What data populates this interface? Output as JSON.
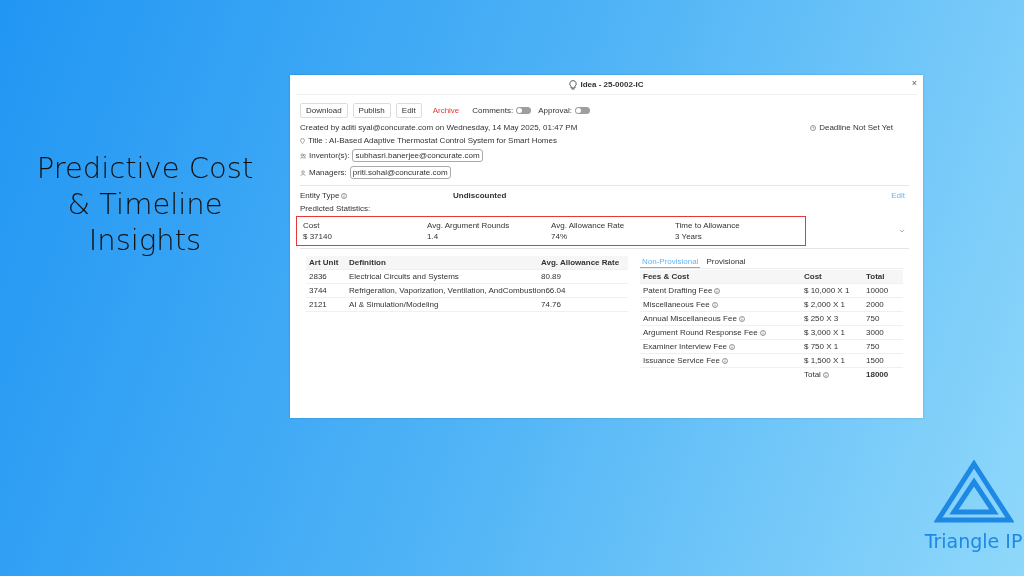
{
  "slide": {
    "heading": "Predictive Cost & Timeline Insights",
    "logo_text": "Triangle IP"
  },
  "window": {
    "title": "Idea - 25-0002-IC",
    "close": "×"
  },
  "toolbar": {
    "actions": [
      {
        "label": "Download",
        "kind": "button"
      },
      {
        "label": "Publish",
        "kind": "button"
      },
      {
        "label": "Edit",
        "kind": "button"
      },
      {
        "label": "Archive",
        "kind": "link"
      }
    ],
    "toggles": [
      {
        "label": "Comments:",
        "on": false
      },
      {
        "label": "Approval:",
        "on": false
      }
    ]
  },
  "created": "Created by aditi syal@concurate.com on Wednesday, 14 May 2025, 01:47 PM",
  "deadline": "Deadline Not Set Yet",
  "title_line": "Title : AI-Based Adaptive Thermostat Control System for Smart Homes",
  "inventors": {
    "label": "Inventor(s):",
    "chips": [
      "subhasri.banerjee@concurate.com"
    ]
  },
  "managers": {
    "label": "Managers:",
    "chips": [
      "priti.sohal@concurate.com"
    ]
  },
  "entity_type": {
    "label": "Entity Type",
    "value": "Undiscounted",
    "edit": "Edit"
  },
  "predicted": {
    "label": "Predicted Statistics:",
    "stats": [
      {
        "label": "Cost",
        "value": "$ 37140"
      },
      {
        "label": "Avg. Argument Rounds",
        "value": "1.4"
      },
      {
        "label": "Avg. Allowance Rate",
        "value": "74%"
      },
      {
        "label": "Time to Allowance",
        "value": "3 Years"
      }
    ]
  },
  "art_units": {
    "columns": [
      "Art Unit",
      "Definition",
      "Avg. Allowance Rate"
    ],
    "rows": [
      [
        "2836",
        "Electrical Circuits and Systems",
        "80.89"
      ],
      [
        "3744",
        "Refrigeration, Vaporization, Ventilation, AndCombustion",
        "66.04"
      ],
      [
        "2121",
        "AI & Simulation/Modeling",
        "74.76"
      ]
    ]
  },
  "fees": {
    "tabs": [
      {
        "label": "Non-Provisional",
        "selected": true
      },
      {
        "label": "Provisional",
        "selected": false
      }
    ],
    "columns": [
      "Fees & Cost",
      "Cost",
      "Total"
    ],
    "rows": [
      [
        "Patent Drafting Fee",
        "$ 10,000 X 1",
        "10000"
      ],
      [
        "Miscellaneous Fee",
        "$ 2,000 X 1",
        "2000"
      ],
      [
        "Annual Miscellaneous Fee",
        "$ 250 X 3",
        "750"
      ],
      [
        "Argument Round Response Fee",
        "$ 3,000 X 1",
        "3000"
      ],
      [
        "Examiner Interview Fee",
        "$ 750 X 1",
        "750"
      ],
      [
        "Issuance Service Fee",
        "$ 1,500 X 1",
        "1500"
      ]
    ],
    "total_label": "Total",
    "total_value": "18000"
  }
}
